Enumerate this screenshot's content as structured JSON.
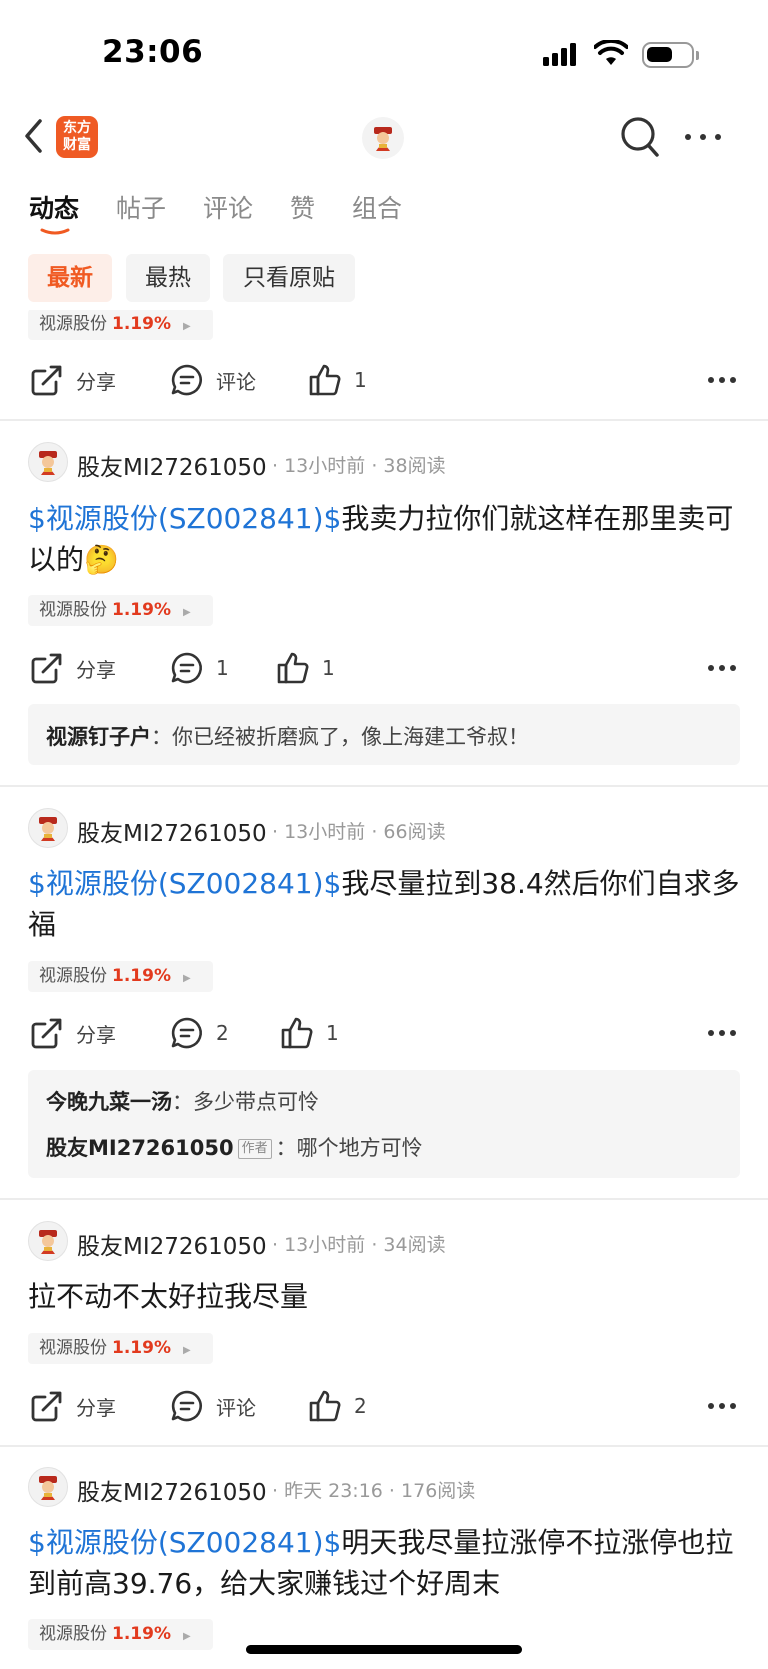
{
  "status_bar": {
    "time": "23:06"
  },
  "nav": {
    "logo_line1": "东方",
    "logo_line2": "财富"
  },
  "tabs": [
    "动态",
    "帖子",
    "评论",
    "赞",
    "组合"
  ],
  "filters": [
    "最新",
    "最热",
    "只看原贴"
  ],
  "actions": {
    "share": "分享",
    "comment": "评论"
  },
  "stock_tag": {
    "name": "视源股份",
    "change": "1.19%"
  },
  "top_partial": {
    "like_count": "1"
  },
  "posts": [
    {
      "author": "股友MI27261050",
      "time": "13小时前",
      "reads": "38阅读",
      "link": "$视源股份(SZ002841)$",
      "text": "我卖力拉你们就这样在那里卖可以的🤔",
      "comment_count": "1",
      "like_count": "1",
      "replies": [
        {
          "user": "视源钉子户",
          "text": "你已经被折磨疯了，像上海建工爷叔！"
        }
      ]
    },
    {
      "author": "股友MI27261050",
      "time": "13小时前",
      "reads": "66阅读",
      "link": "$视源股份(SZ002841)$",
      "text": "我尽量拉到38.4然后你们自求多福",
      "comment_count": "2",
      "like_count": "1",
      "replies": [
        {
          "user": "今晚九菜一汤",
          "text": "多少带点可怜"
        },
        {
          "user": "股友MI27261050",
          "tag": "作者",
          "text": "哪个地方可怜"
        }
      ]
    },
    {
      "author": "股友MI27261050",
      "time": "13小时前",
      "reads": "34阅读",
      "text": "拉不动不太好拉我尽量",
      "like_count": "2"
    },
    {
      "author": "股友MI27261050",
      "time": "昨天 23:16",
      "reads": "176阅读",
      "link": "$视源股份(SZ002841)$",
      "text": "明天我尽量拉涨停不拉涨停也拉到前高39.76，给大家赚钱过个好周末"
    }
  ],
  "colors": {
    "brand": "#ef5a24",
    "link": "#1f74d6",
    "rise": "#e23a1e"
  }
}
